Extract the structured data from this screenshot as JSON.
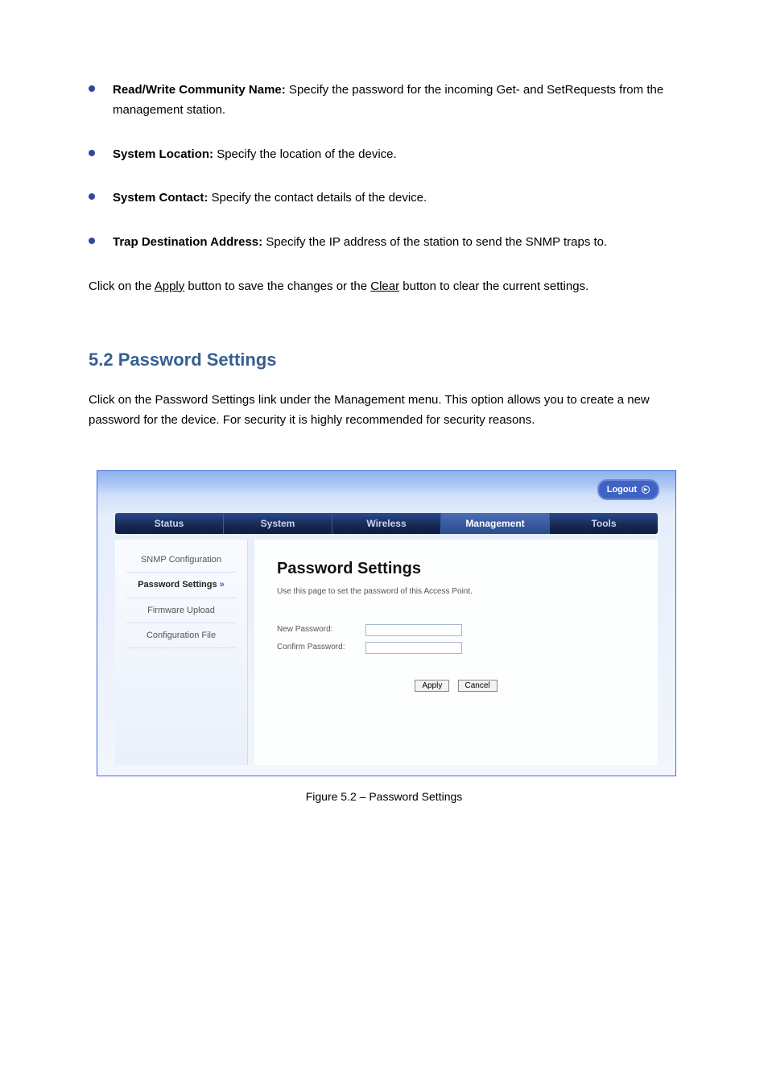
{
  "bullets": {
    "b1_strong": "Read/Write Community Name:",
    "b1_text": " Specify the password for the incoming Get- and SetRequests from the management station.",
    "b2_strong": "System Location:",
    "b2_text": " Specify the location of the device.",
    "b3_strong": "System Contact:",
    "b3_text": " Specify the contact details of the device.",
    "b4_strong": "Trap Destination Address:",
    "b4_text": " Specify the IP address of the station to send the SNMP traps to."
  },
  "buttons_para_prefix": "Click on the ",
  "buttons_para_apply": "Apply",
  "buttons_para_mid": " button to save the changes or the  ",
  "buttons_para_clear": "Clear",
  "buttons_para_suffix": " button to clear the current settings. ",
  "section": {
    "heading_number": "5.2",
    "heading_title": " Password Settings",
    "body": "Click on the Password Settings link under the Management menu. This option allows you to create a new password for the device. For security it is highly recommended for security reasons."
  },
  "ui": {
    "logout": "Logout",
    "tabs": [
      "Status",
      "System",
      "Wireless",
      "Management",
      "Tools"
    ],
    "sidebar": {
      "items": [
        "SNMP Configuration",
        "Password Settings",
        "Firmware Upload",
        "Configuration File"
      ]
    },
    "panel": {
      "title": "Password Settings",
      "desc": "Use this page to set the password of this Access Point.",
      "new_pw_label": "New Password:",
      "confirm_pw_label": "Confirm Password:",
      "apply_btn": "Apply",
      "cancel_btn": "Cancel"
    }
  },
  "figure_caption": "Figure 5.2 – Password Settings"
}
